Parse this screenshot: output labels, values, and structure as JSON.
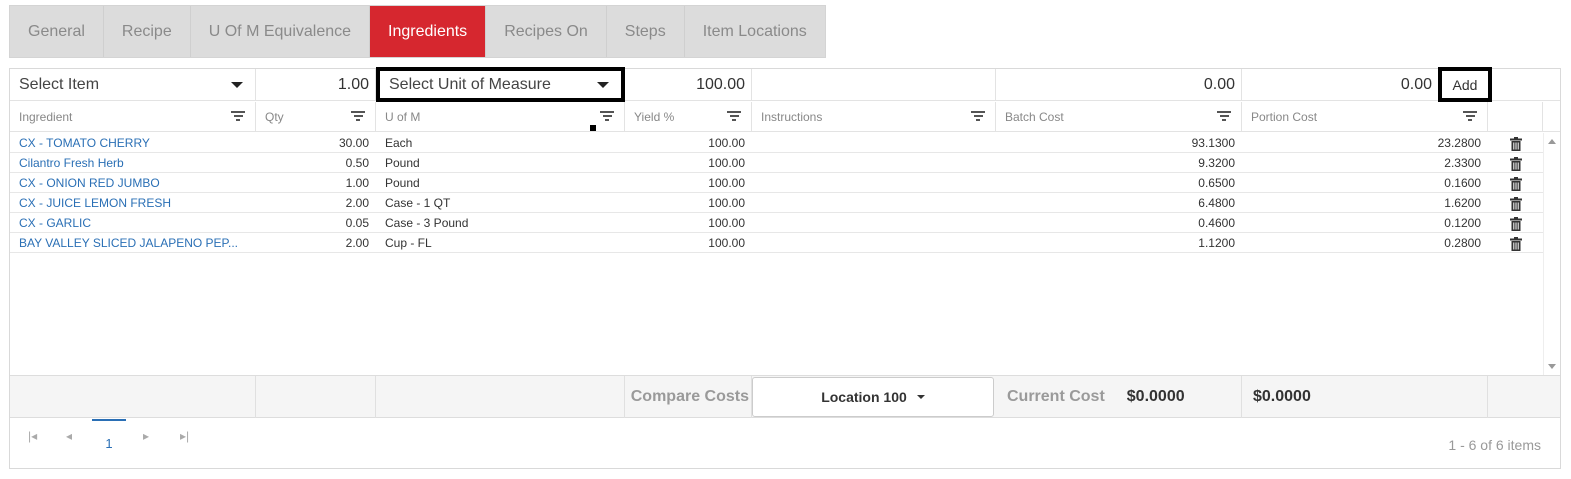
{
  "tabs": [
    "General",
    "Recipe",
    "U Of M Equivalence",
    "Ingredients",
    "Recipes On",
    "Steps",
    "Item Locations"
  ],
  "active_tab": "Ingredients",
  "input_row": {
    "item_placeholder": "Select Item",
    "qty": "1.00",
    "uom_placeholder": "Select Unit of Measure",
    "yield": "100.00",
    "instructions": "",
    "batch_cost": "0.00",
    "portion_cost": "0.00",
    "add_label": "Add"
  },
  "columns": [
    "Ingredient",
    "Qty",
    "U of M",
    "Yield %",
    "Instructions",
    "Batch Cost",
    "Portion Cost"
  ],
  "rows": [
    {
      "ingredient": "CX - TOMATO CHERRY",
      "qty": "30.00",
      "uom": "Each",
      "yield": "100.00",
      "instructions": "",
      "batch": "93.1300",
      "portion": "23.2800"
    },
    {
      "ingredient": "Cilantro Fresh Herb",
      "qty": "0.50",
      "uom": "Pound",
      "yield": "100.00",
      "instructions": "",
      "batch": "9.3200",
      "portion": "2.3300"
    },
    {
      "ingredient": "CX - ONION RED JUMBO",
      "qty": "1.00",
      "uom": "Pound",
      "yield": "100.00",
      "instructions": "",
      "batch": "0.6500",
      "portion": "0.1600"
    },
    {
      "ingredient": "CX - JUICE LEMON FRESH",
      "qty": "2.00",
      "uom": "Case - 1 QT",
      "yield": "100.00",
      "instructions": "",
      "batch": "6.4800",
      "portion": "1.6200"
    },
    {
      "ingredient": "CX - GARLIC",
      "qty": "0.05",
      "uom": "Case - 3 Pound",
      "yield": "100.00",
      "instructions": "",
      "batch": "0.4600",
      "portion": "0.1200"
    },
    {
      "ingredient": "BAY VALLEY SLICED JALAPENO PEP...",
      "qty": "2.00",
      "uom": "Cup - FL",
      "yield": "100.00",
      "instructions": "",
      "batch": "1.1200",
      "portion": "0.2800"
    }
  ],
  "footer": {
    "compare_label": "Compare Costs",
    "location_label": "Location 100",
    "current_cost_label": "Current Cost",
    "current_cost_value": "$0.0000",
    "portion_total": "$0.0000"
  },
  "pager": {
    "current_page": "1",
    "info": "1 - 6 of 6 items"
  },
  "colors": {
    "active_tab": "#d6272f",
    "link": "#2a6fb5"
  }
}
